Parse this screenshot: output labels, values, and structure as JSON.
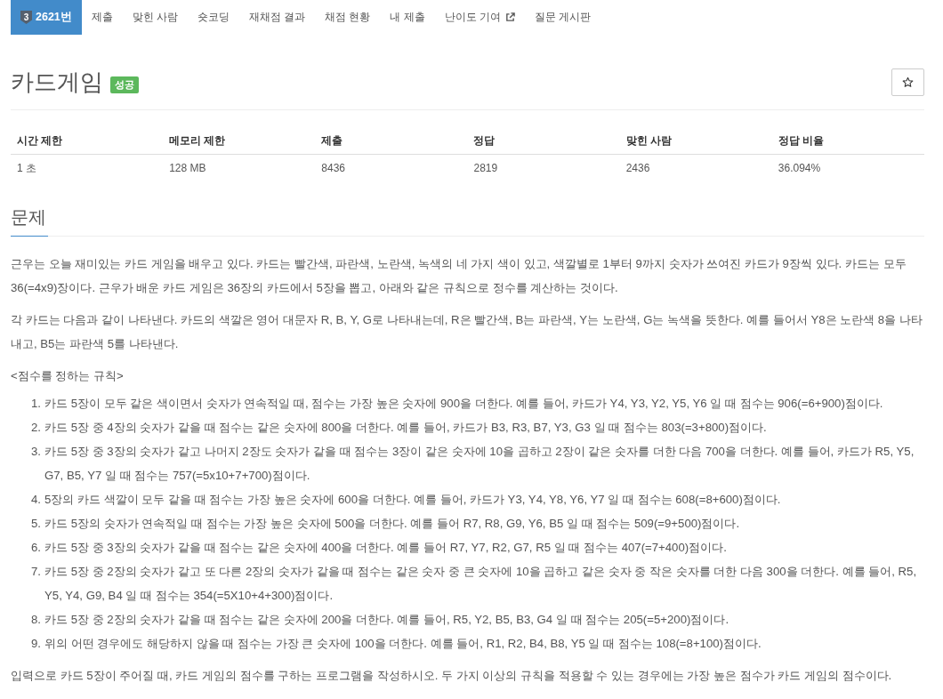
{
  "nav": {
    "tabs": [
      {
        "label": "2621번",
        "badge": "3",
        "selected": true,
        "external": false
      },
      {
        "label": "제출",
        "selected": false,
        "external": false
      },
      {
        "label": "맞힌 사람",
        "selected": false,
        "external": false
      },
      {
        "label": "숏코딩",
        "selected": false,
        "external": false
      },
      {
        "label": "재채점 결과",
        "selected": false,
        "external": false
      },
      {
        "label": "채점 현황",
        "selected": false,
        "external": false
      },
      {
        "label": "내 제출",
        "selected": false,
        "external": false
      },
      {
        "label": "난이도 기여",
        "selected": false,
        "external": true
      },
      {
        "label": "질문 게시판",
        "selected": false,
        "external": false
      }
    ]
  },
  "problem": {
    "title": "카드게임",
    "result": {
      "label": "성공",
      "kind": "success"
    }
  },
  "info_table": {
    "columns": [
      "시간 제한",
      "메모리 제한",
      "제출",
      "정답",
      "맞힌 사람",
      "정답 비율"
    ],
    "rows": [
      [
        "1 초",
        "128 MB",
        "8436",
        "2819",
        "2436",
        "36.094%"
      ]
    ]
  },
  "statement": {
    "heading": "문제",
    "paragraphs": [
      "근우는 오늘 재미있는 카드 게임을 배우고 있다. 카드는 빨간색, 파란색, 노란색, 녹색의 네 가지 색이 있고, 색깔별로 1부터 9까지 숫자가 쓰여진 카드가 9장씩 있다. 카드는 모두 36(=4x9)장이다. 근우가 배운 카드 게임은 36장의 카드에서 5장을 뽑고, 아래와 같은 규칙으로 정수를 계산하는 것이다.",
      "각 카드는 다음과 같이 나타낸다. 카드의 색깔은 영어 대문자 R, B, Y, G로 나타내는데, R은 빨간색, B는 파란색, Y는 노란색, G는 녹색을 뜻한다. 예를 들어서 Y8은 노란색 8을 나타내고, B5는 파란색 5를 나타낸다.",
      "<점수를 정하는 규칙>"
    ],
    "rules": [
      {
        "number": "1.",
        "text": "카드 5장이 모두 같은 색이면서 숫자가 연속적일 때, 점수는 가장 높은 숫자에 900을 더한다. 예를 들어, 카드가 Y4, Y3, Y2, Y5, Y6 일 때 점수는 906(=6+900)점이다."
      },
      {
        "number": "2.",
        "text": "카드 5장 중 4장의 숫자가 같을 때 점수는 같은 숫자에 800을 더한다. 예를 들어, 카드가 B3, R3, B7, Y3, G3 일 때 점수는 803(=3+800)점이다."
      },
      {
        "number": "3.",
        "text": "카드 5장 중 3장의 숫자가 같고 나머지 2장도 숫자가 같을 때 점수는 3장이 같은 숫자에 10을 곱하고 2장이 같은 숫자를 더한 다음 700을 더한다. 예를 들어, 카드가 R5, Y5, G7, B5, Y7 일 때 점수는 757(=5x10+7+700)점이다."
      },
      {
        "number": "4.",
        "text": "5장의 카드 색깔이 모두 같을 때 점수는 가장 높은 숫자에 600을 더한다. 예를 들어, 카드가 Y3, Y4, Y8, Y6, Y7 일 때 점수는 608(=8+600)점이다."
      },
      {
        "number": "5.",
        "text": "카드 5장의 숫자가 연속적일 때 점수는 가장 높은 숫자에 500을 더한다. 예를 들어 R7, R8, G9, Y6, B5 일 때 점수는 509(=9+500)점이다."
      },
      {
        "number": "6.",
        "text": "카드 5장 중 3장의 숫자가 같을 때 점수는 같은 숫자에 400을 더한다. 예를 들어 R7, Y7, R2, G7, R5 일 때 점수는 407(=7+400)점이다."
      },
      {
        "number": "7.",
        "text": "카드 5장 중 2장의 숫자가 같고 또 다른 2장의 숫자가 같을 때 점수는 같은 숫자 중 큰 숫자에 10을 곱하고 같은 숫자 중 작은 숫자를 더한 다음 300을 더한다. 예를 들어, R5, Y5, Y4, G9, B4 일 때 점수는 354(=5X10+4+300)점이다."
      },
      {
        "number": "8.",
        "text": "카드 5장 중 2장의 숫자가 같을 때 점수는 같은 숫자에 200을 더한다. 예를 들어, R5, Y2, B5, B3, G4 일 때 점수는 205(=5+200)점이다."
      },
      {
        "number": "9.",
        "text": "위의 어떤 경우에도 해당하지 않을 때 점수는 가장 큰 숫자에 100을 더한다. 예를 들어, R1, R2, B4, B8, Y5 일 때 점수는 108(=8+100)점이다."
      }
    ],
    "closing": "입력으로 카드 5장이 주어질 때, 카드 게임의 점수를 구하는 프로그램을 작성하시오. 두 가지 이상의 규칙을 적용할 수 있는 경우에는 가장 높은 점수가 카드 게임의 점수이다."
  }
}
